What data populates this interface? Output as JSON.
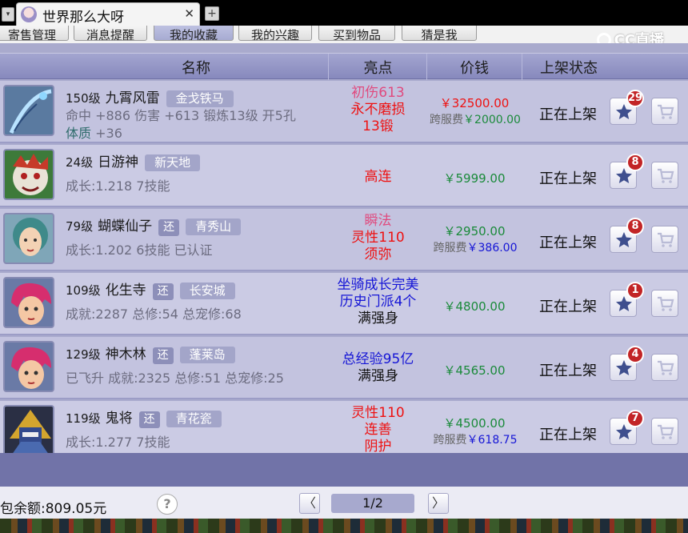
{
  "window": {
    "tab_title": "世界那么大呀",
    "tab_menu_icon": "▾",
    "close_icon": "✕",
    "add_icon": "+"
  },
  "subnav": {
    "buttons": [
      "寄售管理",
      "消息提醒",
      "我的收藏",
      "我的兴趣",
      "买到物品",
      "猜是我"
    ],
    "active_index": 2
  },
  "brand": {
    "logo_text": "CC直播"
  },
  "table": {
    "headers": {
      "name": "名称",
      "highlight": "亮点",
      "price": "价钱",
      "status": "上架状态"
    },
    "rows": [
      {
        "level": "150级",
        "name": "九霄风雷",
        "huan": "",
        "tag": "金戈铁马",
        "detail": "命中 +886 伤害 +613 锻炼13级 开5孔",
        "detail3_label": "体质",
        "detail3_value": "+36",
        "highlights": [
          {
            "text": "初伤613",
            "color": "pink"
          },
          {
            "text": "永不磨损",
            "color": "red"
          },
          {
            "text": "13锻",
            "color": "red"
          }
        ],
        "price": "￥32500.00",
        "price_color": "red",
        "fee_label": "跨服费",
        "fee": "￥2000.00",
        "fee_color": "green",
        "status": "正在上架",
        "fav_count": "29",
        "thumb": "bow"
      },
      {
        "level": "24级",
        "name": "日游神",
        "huan": "",
        "tag": "新天地",
        "detail": "成长:1.218 7技能",
        "highlights": [
          {
            "text": "高连",
            "color": "red"
          }
        ],
        "price": "￥5999.00",
        "price_color": "green",
        "fee_label": "",
        "fee": "",
        "status": "正在上架",
        "fav_count": "8",
        "thumb": "beast"
      },
      {
        "level": "79级",
        "name": "蝴蝶仙子",
        "huan": "还",
        "tag": "青秀山",
        "detail": "成长:1.202 6技能 已认证",
        "highlights": [
          {
            "text": "瞬法",
            "color": "pink"
          },
          {
            "text": "灵性110",
            "color": "red"
          },
          {
            "text": "须弥",
            "color": "red"
          }
        ],
        "price": "￥2950.00",
        "price_color": "green",
        "fee_label": "跨服费",
        "fee": "￥386.00",
        "fee_color": "blue",
        "status": "正在上架",
        "fav_count": "8",
        "thumb": "fairy"
      },
      {
        "level": "109级",
        "name": "化生寺",
        "huan": "还",
        "tag": "长安城",
        "detail": "成就:2287 总修:54 总宠修:68",
        "highlights": [
          {
            "text": "坐骑成长完美",
            "color": "blue"
          },
          {
            "text": "历史门派4个",
            "color": "blue"
          },
          {
            "text": "满强身",
            "color": "black"
          }
        ],
        "price": "￥4800.00",
        "price_color": "green",
        "fee_label": "",
        "fee": "",
        "status": "正在上架",
        "fav_count": "1",
        "thumb": "hero"
      },
      {
        "level": "129级",
        "name": "神木林",
        "huan": "还",
        "tag": "蓬莱岛",
        "detail": "已飞升 成就:2325 总修:51 总宠修:25",
        "highlights": [
          {
            "text": "总经验95亿",
            "color": "blue"
          },
          {
            "text": "满强身",
            "color": "black"
          }
        ],
        "price": "￥4565.00",
        "price_color": "green",
        "fee_label": "",
        "fee": "",
        "status": "正在上架",
        "fav_count": "4",
        "thumb": "hero"
      },
      {
        "level": "119级",
        "name": "鬼将",
        "huan": "还",
        "tag": "青花瓷",
        "detail": "成长:1.277 7技能",
        "highlights": [
          {
            "text": "灵性110",
            "color": "red"
          },
          {
            "text": "连善",
            "color": "red"
          },
          {
            "text": "阴护",
            "color": "red"
          }
        ],
        "price": "￥4500.00",
        "price_color": "green",
        "fee_label": "跨服费",
        "fee": "￥618.75",
        "fee_color": "blue",
        "status": "正在上架",
        "fav_count": "7",
        "thumb": "warrior"
      }
    ]
  },
  "footer": {
    "balance": "包余额:809.05元",
    "help": "?",
    "prev": "〈",
    "next": "〉",
    "page": "1/2"
  },
  "colors": {
    "panel": "#a9aacd",
    "header": "#8789bd",
    "badge": "#c22426",
    "star": "#3f4f8e"
  }
}
